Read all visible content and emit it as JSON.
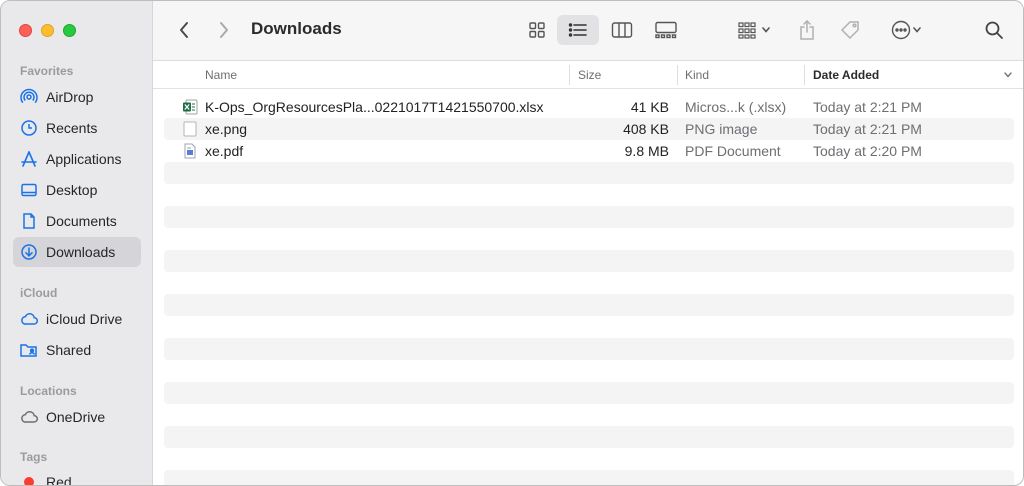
{
  "window": {
    "title": "Downloads"
  },
  "sidebar": {
    "sections": {
      "favorites": "Favorites",
      "icloud": "iCloud",
      "locations": "Locations",
      "tags": "Tags"
    },
    "favorites": [
      {
        "label": "AirDrop",
        "icon": "airdrop-icon"
      },
      {
        "label": "Recents",
        "icon": "clock-icon"
      },
      {
        "label": "Applications",
        "icon": "applications-icon"
      },
      {
        "label": "Desktop",
        "icon": "desktop-icon"
      },
      {
        "label": "Documents",
        "icon": "document-icon"
      },
      {
        "label": "Downloads",
        "icon": "download-icon",
        "selected": true
      }
    ],
    "icloud": [
      {
        "label": "iCloud Drive",
        "icon": "cloud-icon"
      },
      {
        "label": "Shared",
        "icon": "shared-folder-icon"
      }
    ],
    "locations": [
      {
        "label": "OneDrive",
        "icon": "cloud-icon"
      }
    ],
    "tags": [
      {
        "label": "Red",
        "color": "#ff3b30"
      }
    ]
  },
  "columns": {
    "name": "Name",
    "size": "Size",
    "kind": "Kind",
    "date_added": "Date Added"
  },
  "files": [
    {
      "name": "K-Ops_OrgResourcesPla...0221017T1421550700.xlsx",
      "size": "41 KB",
      "kind": "Micros...k (.xlsx)",
      "date": "Today at 2:21 PM",
      "icon": "excel-file-icon"
    },
    {
      "name": "xe.png",
      "size": "408 KB",
      "kind": "PNG image",
      "date": "Today at 2:21 PM",
      "icon": "image-file-icon"
    },
    {
      "name": "xe.pdf",
      "size": "9.8 MB",
      "kind": "PDF Document",
      "date": "Today at 2:20 PM",
      "icon": "pdf-file-icon"
    }
  ],
  "colors": {
    "sidebar_bg": "#e9e8ea",
    "accent_blue": "#1a73e8",
    "excel_green": "#1d6f42"
  }
}
